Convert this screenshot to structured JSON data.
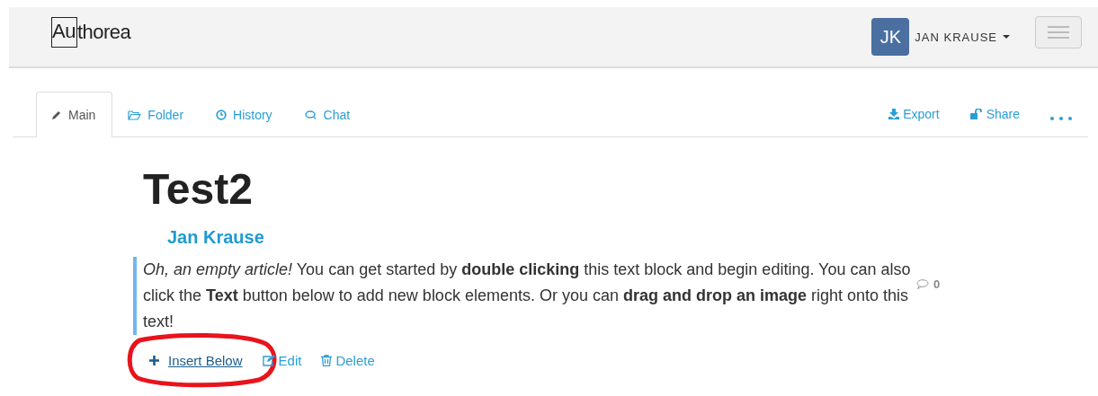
{
  "navbar": {
    "logo_boxed": "Au",
    "logo_rest": "thorea",
    "user": {
      "initials": "JK",
      "name": "JAN KRAUSE"
    }
  },
  "tabs": [
    {
      "label": "Main",
      "kind": "pencil",
      "selected": true
    },
    {
      "label": "Folder",
      "kind": "folder",
      "selected": false
    },
    {
      "label": "History",
      "kind": "clock",
      "selected": false
    },
    {
      "label": "Chat",
      "kind": "chat",
      "selected": false
    }
  ],
  "tab_actions": [
    {
      "label": "Export",
      "kind": "download"
    },
    {
      "label": "Share",
      "kind": "unlock"
    }
  ],
  "article": {
    "title": "Test2",
    "author": "Jan Krause",
    "block": {
      "text": "*Oh, an empty article!* You can get started by **double clicking** this text block and begin editing. You can also click the **Text** button below to add new block elements. Or you can **drag and drop an image** right onto this text!",
      "comment_count": "0"
    },
    "block_actions": [
      {
        "label": "Insert Below",
        "kind": "plus",
        "highlighted": true
      },
      {
        "label": "Edit",
        "kind": "edit",
        "highlighted": false
      },
      {
        "label": "Delete",
        "kind": "trash",
        "highlighted": false
      }
    ]
  }
}
